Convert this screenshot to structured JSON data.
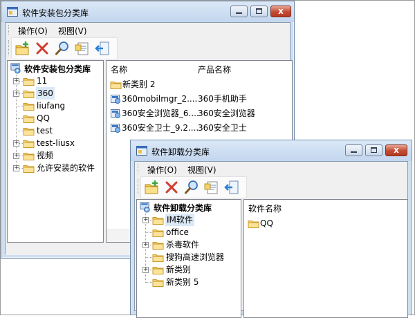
{
  "window1": {
    "title": "软件安装包分类库",
    "controls": {
      "close": "x"
    },
    "menu": [
      "操作(O)",
      "视图(V)"
    ],
    "toolbar": [
      "new-folder-icon",
      "delete-icon",
      "search-icon",
      "properties-icon",
      "import-icon"
    ],
    "tree": {
      "root": "软件安装包分类库",
      "items": [
        {
          "label": "11",
          "expandable": true
        },
        {
          "label": "360",
          "expandable": true,
          "selected": true
        },
        {
          "label": "liufang",
          "expandable": false
        },
        {
          "label": "QQ",
          "expandable": false
        },
        {
          "label": "test",
          "expandable": false
        },
        {
          "label": "test-liusx",
          "expandable": true
        },
        {
          "label": "视频",
          "expandable": true
        },
        {
          "label": "允许安装的软件",
          "expandable": true
        }
      ]
    },
    "list": {
      "columns": [
        "名称",
        "产品名称"
      ],
      "rows": [
        {
          "name": "新类别 2",
          "product": "",
          "icon": "folder-icon"
        },
        {
          "name": "360mobilmgr_2....",
          "product": "360手机助手",
          "icon": "package-icon"
        },
        {
          "name": "360安全浏览器_6....",
          "product": "360安全浏览器",
          "icon": "package-icon"
        },
        {
          "name": "360安全卫士_9.2....",
          "product": "360安全卫士",
          "icon": "package-icon"
        }
      ]
    }
  },
  "window2": {
    "title": "软件卸载分类库",
    "controls": {
      "close": "x"
    },
    "menu": [
      "操作(O)",
      "视图(V)"
    ],
    "toolbar": [
      "new-folder-icon",
      "delete-icon",
      "search-icon",
      "properties-icon",
      "import-icon"
    ],
    "tree": {
      "root": "软件卸载分类库",
      "items": [
        {
          "label": "IM软件",
          "expandable": true,
          "selected": true
        },
        {
          "label": "office",
          "expandable": false
        },
        {
          "label": "杀毒软件",
          "expandable": true
        },
        {
          "label": "搜狗高速浏览器",
          "expandable": false
        },
        {
          "label": "新类别",
          "expandable": true
        },
        {
          "label": "新类别 5",
          "expandable": false
        }
      ]
    },
    "list": {
      "columns": [
        "软件名称"
      ],
      "rows": [
        {
          "name": "QQ",
          "icon": "folder-icon"
        }
      ]
    }
  },
  "colors": {
    "folder": "#f2c94c",
    "delete": "#d13b2f",
    "accent": "#2b7fd6"
  }
}
